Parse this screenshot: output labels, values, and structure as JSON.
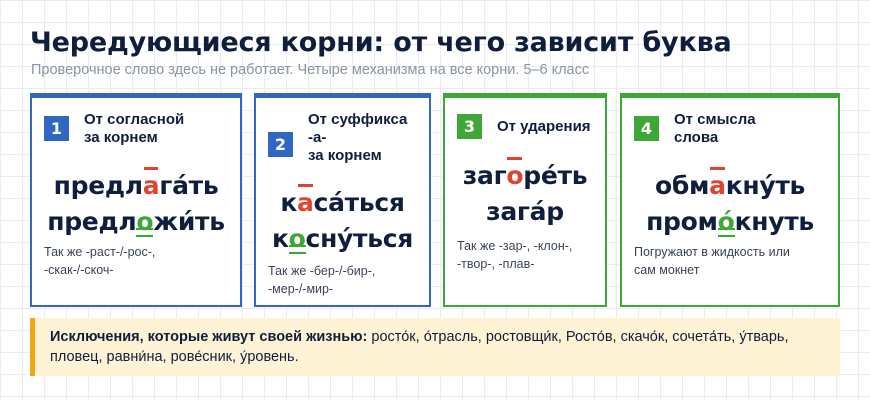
{
  "header": {
    "title": "Чередующиеся корни: от чего зависит буква",
    "subtitle": "Проверочное слово здесь не работает. Четыре механизма на все корни. 5–6 класс"
  },
  "cards": [
    {
      "number": "1",
      "title_lines": [
        "От согласной",
        "за корнем"
      ],
      "words": [
        {
          "pre": "предл",
          "hl": "а",
          "post": "га́ть"
        },
        {
          "pre": "предл",
          "hl": "о",
          "post": "жи́ть"
        }
      ],
      "note_lines": [
        "Так же -раст-/-рос-,",
        "-скак-/-скоч-"
      ]
    },
    {
      "number": "2",
      "title_lines": [
        "От суффикса",
        "-а-",
        "за корнем"
      ],
      "words": [
        {
          "pre": "к",
          "hl": "а",
          "post": "са́ться"
        },
        {
          "pre": "к",
          "hl": "о",
          "post": "сну́ться"
        }
      ],
      "note_lines": [
        "Так же -бер-/-бир-,",
        "-мер-/-мир-"
      ]
    },
    {
      "number": "3",
      "title_lines": [
        "От ударения"
      ],
      "words": [
        {
          "pre": "заг",
          "hl": "о",
          "post": "ре́ть"
        },
        {
          "pre": "зага́р",
          "hl": "",
          "post": ""
        }
      ],
      "note_lines": [
        "Так же -зар-, -клон-,",
        "-твор-, -плав-"
      ]
    },
    {
      "number": "4",
      "title_lines": [
        "От смысла",
        "слова"
      ],
      "words": [
        {
          "pre": "обм",
          "hl": "а",
          "post": "кну́ть"
        },
        {
          "pre": "пром",
          "hl": "о́",
          "post": "кнуть"
        }
      ],
      "note_lines": [
        "Погружают в жидкость или",
        "сам мокнет"
      ]
    }
  ],
  "exceptions": {
    "label": "Исключения, которые живут своей жизнью:",
    "text": "росто́к, о́трасль, ростовщи́к, Росто́в, скачо́к, сочета́ть, у́тварь, пловец, равни́на, рове́сник, у́ровень."
  },
  "colors": {
    "blue": "#2f67c3",
    "green": "#3ea836",
    "red": "#e0442e",
    "accent_orange": "#f2a516"
  }
}
